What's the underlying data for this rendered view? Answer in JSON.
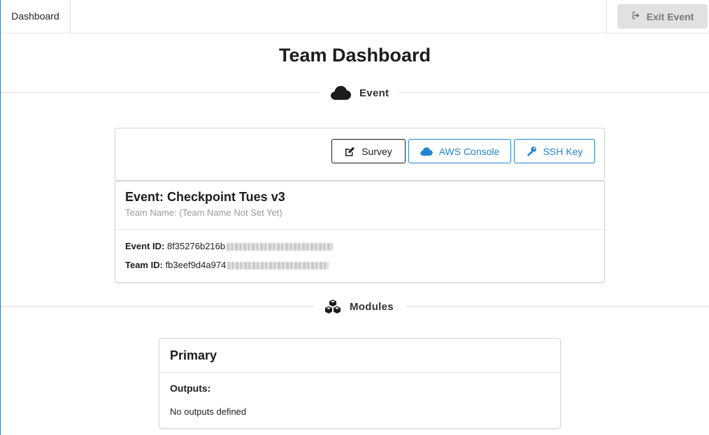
{
  "nav": {
    "dashboard_label": "Dashboard",
    "exit_label": "Exit Event"
  },
  "page": {
    "title": "Team Dashboard"
  },
  "sections": {
    "event_label": "Event",
    "modules_label": "Modules"
  },
  "actions": {
    "survey_label": "Survey",
    "aws_console_label": "AWS Console",
    "ssh_key_label": "SSH Key"
  },
  "event": {
    "title": "Event: Checkpoint Tues v3",
    "team_name": "Team Name: (Team Name Not Set Yet)",
    "event_id_label": "Event ID:",
    "event_id_value": "8f35276b216b",
    "team_id_label": "Team ID:",
    "team_id_value": "fb3eef9d4a974"
  },
  "module": {
    "name": "Primary",
    "outputs_label": "Outputs:",
    "outputs_empty": "No outputs defined"
  },
  "colors": {
    "accent_blue": "#2185d0",
    "button_gray": "#e0e1e2",
    "text_dark": "#1b1c1d"
  },
  "icons": {
    "exit": "sign-out-icon",
    "event": "cloud-icon",
    "modules": "cubes-icon",
    "survey": "edit-icon",
    "aws": "cloud-icon",
    "ssh": "key-icon"
  }
}
